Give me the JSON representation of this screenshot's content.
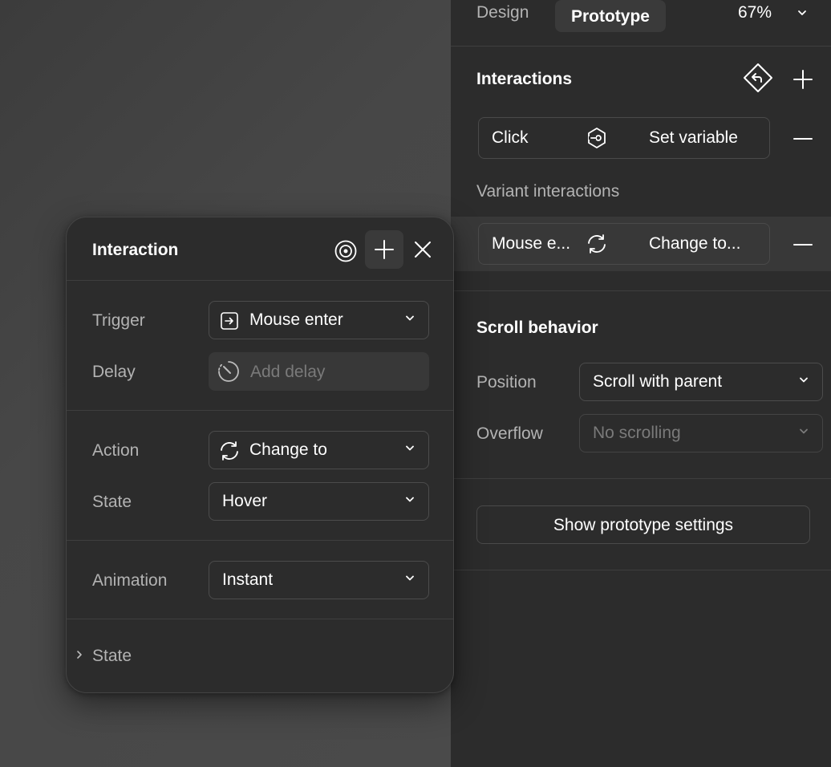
{
  "header": {
    "tab_design": "Design",
    "tab_prototype": "Prototype",
    "zoom": "67%"
  },
  "interactions": {
    "title": "Interactions",
    "items": [
      {
        "trigger": "Click",
        "action": "Set variable"
      }
    ],
    "variant_title": "Variant interactions",
    "variant_items": [
      {
        "trigger": "Mouse e...",
        "action": "Change to..."
      }
    ]
  },
  "scroll": {
    "title": "Scroll behavior",
    "position_label": "Position",
    "position_value": "Scroll with parent",
    "overflow_label": "Overflow",
    "overflow_value": "No scrolling"
  },
  "prototype_settings_button": "Show prototype settings",
  "popup": {
    "title": "Interaction",
    "trigger_label": "Trigger",
    "trigger_value": "Mouse enter",
    "delay_label": "Delay",
    "delay_placeholder": "Add delay",
    "action_label": "Action",
    "action_value": "Change to",
    "state_label": "State",
    "state_value": "Hover",
    "animation_label": "Animation",
    "animation_value": "Instant",
    "state_section": "State"
  },
  "colors": {
    "panel_bg": "#2c2c2c",
    "canvas_bg": "#474747",
    "border": "#4a4a4a",
    "text": "#ffffff",
    "muted": "#b3b3b3"
  }
}
